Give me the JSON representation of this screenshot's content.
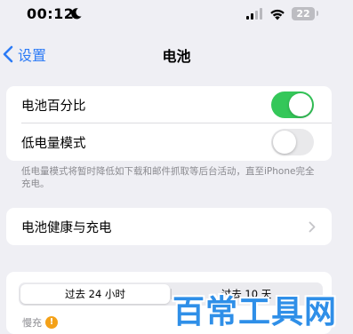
{
  "status_bar": {
    "time": "00:12",
    "moon_icon": "moon-icon",
    "signal_icon": "cellular-signal-icon",
    "wifi_icon": "wifi-icon",
    "battery_level": "22"
  },
  "nav": {
    "back_label": "设置",
    "title": "电池",
    "accent_color": "#2c7bf6"
  },
  "settings": {
    "battery_percentage": {
      "label": "电池百分比",
      "enabled": true
    },
    "low_power_mode": {
      "label": "低电量模式",
      "enabled": false
    },
    "footnote": "低电量模式将暂时降低如下载和邮件抓取等后台活动，直至iPhone完全充电。"
  },
  "health": {
    "label": "电池健康与充电"
  },
  "usage": {
    "segments": [
      "过去 24 小时",
      "过去 10 天"
    ],
    "selected_segment": "过去 24 小时",
    "charge_label": "慢充",
    "info_icon": "!"
  },
  "colors": {
    "toggle_on": "#34c759",
    "toggle_off": "#e9e9eb",
    "background": "#efeff4"
  },
  "watermark": "百常工具网"
}
